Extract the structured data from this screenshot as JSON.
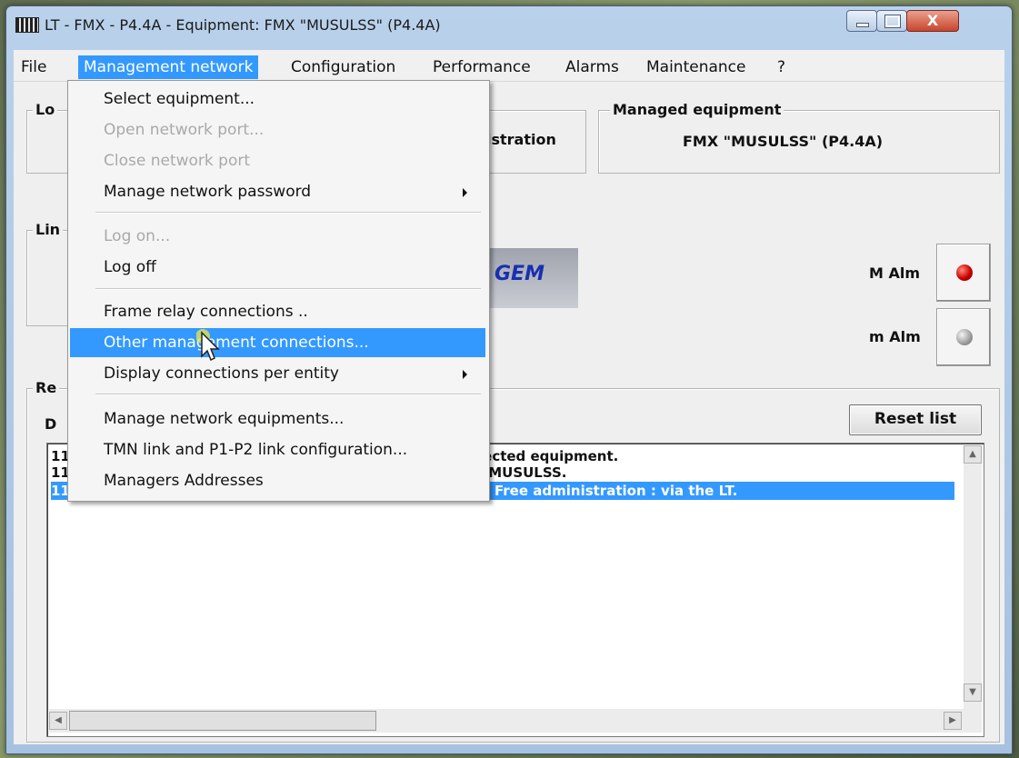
{
  "window": {
    "title": "LT - FMX - P4.4A - Equipment: FMX \"MUSULSS\" (P4.4A)",
    "close_glyph": "X"
  },
  "menubar": {
    "items": [
      "File",
      "Management network",
      "Configuration",
      "Performance",
      "Alarms",
      "Maintenance",
      "?"
    ],
    "active": "Management network"
  },
  "dropdown": {
    "items": [
      {
        "label": "Select equipment...",
        "enabled": true
      },
      {
        "label": "Open network port...",
        "enabled": false
      },
      {
        "label": "Close network port",
        "enabled": false
      },
      {
        "label": "Manage network password",
        "enabled": true,
        "submenu": true
      },
      {
        "label": "Log on...",
        "enabled": false
      },
      {
        "label": "Log off",
        "enabled": true
      },
      {
        "label": "Frame relay connections ..",
        "enabled": true
      },
      {
        "label": "Other management connections...",
        "enabled": true,
        "highlighted": true
      },
      {
        "label": "Display connections per entity",
        "enabled": true,
        "submenu": true
      },
      {
        "label": "Manage network equipments...",
        "enabled": true
      },
      {
        "label": "TMN link and P1-P2 link configuration...",
        "enabled": true
      },
      {
        "label": "Managers Addresses",
        "enabled": true
      }
    ]
  },
  "panels": {
    "local_label": "Lo",
    "admin_text": "istration",
    "managed_title": "Managed equipment",
    "managed_value": "FMX \"MUSULSS\" (P4.4A)",
    "link_label": "Lin",
    "logo_text": "GEM",
    "report_label": "Re",
    "report_sub": "D"
  },
  "alarms": {
    "major_label": "M Alm",
    "minor_label": "m Alm",
    "major_color": "#cc0000",
    "minor_color": "#9b9b9b"
  },
  "buttons": {
    "reset_list": "Reset list"
  },
  "log": {
    "rows": [
      {
        "prefix": "11",
        "text": "lected equipment."
      },
      {
        "prefix": "11",
        "text": ": MUSULSS."
      },
      {
        "prefix": "11",
        "text": "Free administration : via the LT."
      }
    ]
  },
  "colors": {
    "selection": "#3399ff"
  }
}
